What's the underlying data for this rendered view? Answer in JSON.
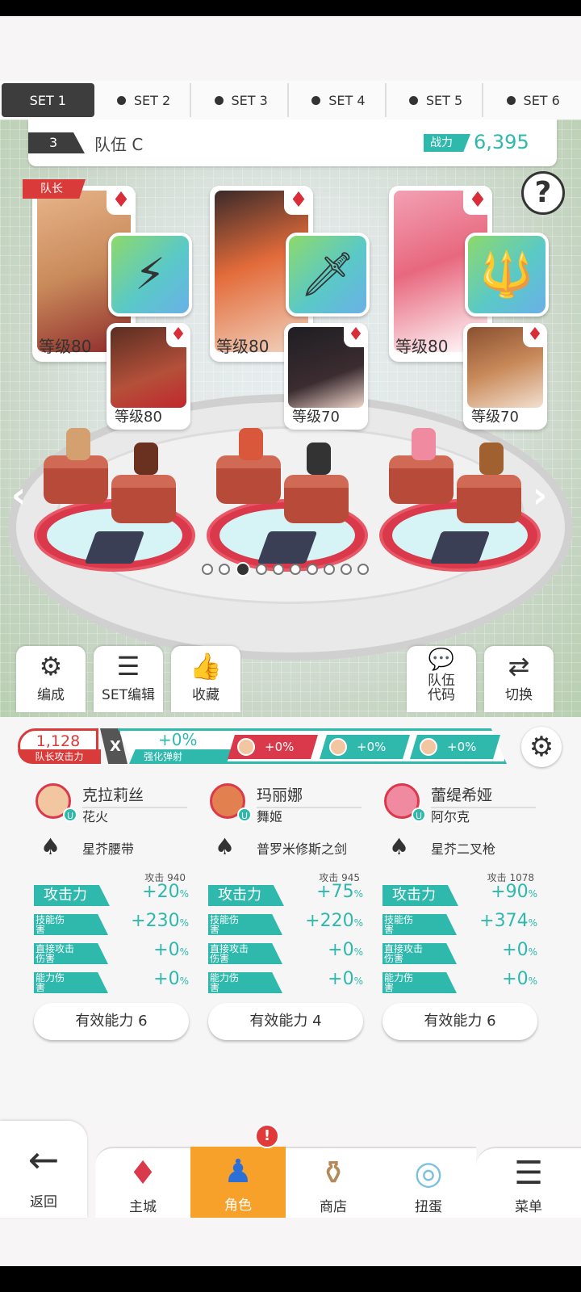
{
  "tabs": [
    {
      "label": "SET 1",
      "active": true
    },
    {
      "label": "SET 2"
    },
    {
      "label": "SET 3"
    },
    {
      "label": "SET 4"
    },
    {
      "label": "SET 5"
    },
    {
      "label": "SET 6"
    }
  ],
  "team": {
    "number": "3",
    "name": "队伍 C",
    "power_label": "战力",
    "power_value": "6,395"
  },
  "help_label": "?",
  "leader_label": "队长",
  "slots": [
    {
      "level": "等级80",
      "sub_level": "等级80",
      "weapon_icon": "belt-icon"
    },
    {
      "level": "等级80",
      "sub_level": "等级70",
      "weapon_icon": "sword-icon"
    },
    {
      "level": "等级80",
      "sub_level": "等级70",
      "weapon_icon": "trident-icon"
    }
  ],
  "suit_glyph": "♦",
  "page_dots": {
    "count": 10,
    "active_index": 2
  },
  "actions": [
    {
      "name": "formation",
      "label": "编成",
      "icon": "formation-icon"
    },
    {
      "name": "set-edit",
      "label": "SET编辑",
      "icon": "list-icon"
    },
    {
      "name": "favorite",
      "label": "收藏",
      "icon": "thumbs-up-icon"
    },
    {
      "name": "team-code",
      "label": "队伍\n代码",
      "icon": "chat-icon"
    },
    {
      "name": "switch",
      "label": "切换",
      "icon": "switch-icon"
    }
  ],
  "leader_attack": {
    "value": "1,128",
    "label": "队长攻击力"
  },
  "multiply": "X",
  "boost": {
    "value": "+0%",
    "label": "强化弹射"
  },
  "chips": [
    {
      "value": "+0%",
      "color": "#d9394a"
    },
    {
      "value": "+0%",
      "color": "#2fb9ad"
    },
    {
      "value": "+0%",
      "color": "#2fb9ad"
    }
  ],
  "heroes": [
    {
      "name": "克拉莉丝",
      "partner": "花火",
      "weapon": "星芥腰带",
      "atk_caption": "攻击  940",
      "stats": [
        {
          "label": "攻击力",
          "value": "+20"
        },
        {
          "label": "技能伤害",
          "value": "+230"
        },
        {
          "label": "直接攻击伤害",
          "value": "+0"
        },
        {
          "label": "能力伤害",
          "value": "+0"
        }
      ],
      "effective": "有效能力 6"
    },
    {
      "name": "玛丽娜",
      "partner": "舞姬",
      "weapon": "普罗米修斯之剑",
      "atk_caption": "攻击  945",
      "stats": [
        {
          "label": "攻击力",
          "value": "+75"
        },
        {
          "label": "技能伤害",
          "value": "+220"
        },
        {
          "label": "直接攻击伤害",
          "value": "+0"
        },
        {
          "label": "能力伤害",
          "value": "+0"
        }
      ],
      "effective": "有效能力 4"
    },
    {
      "name": "蕾缇希娅",
      "partner": "阿尔克",
      "weapon": "星芥二叉枪",
      "atk_caption": "攻击 1078",
      "stats": [
        {
          "label": "攻击力",
          "value": "+90"
        },
        {
          "label": "技能伤害",
          "value": "+374"
        },
        {
          "label": "直接攻击伤害",
          "value": "+0"
        },
        {
          "label": "能力伤害",
          "value": "+0"
        }
      ],
      "effective": "有效能力 6"
    }
  ],
  "percent": "%",
  "nav": [
    {
      "label": "返回",
      "icon": "back-arrow-icon"
    },
    {
      "label": "主城",
      "icon": "castle-icon"
    },
    {
      "label": "角色",
      "icon": "character-icon",
      "active": true,
      "alert": "!"
    },
    {
      "label": "商店",
      "icon": "shop-icon"
    },
    {
      "label": "扭蛋",
      "icon": "gacha-icon"
    },
    {
      "label": "菜单",
      "icon": "menu-icon"
    }
  ],
  "colors": {
    "accent": "#2fb9ad",
    "red": "#d9394a",
    "active_nav": "#f7a12a"
  }
}
